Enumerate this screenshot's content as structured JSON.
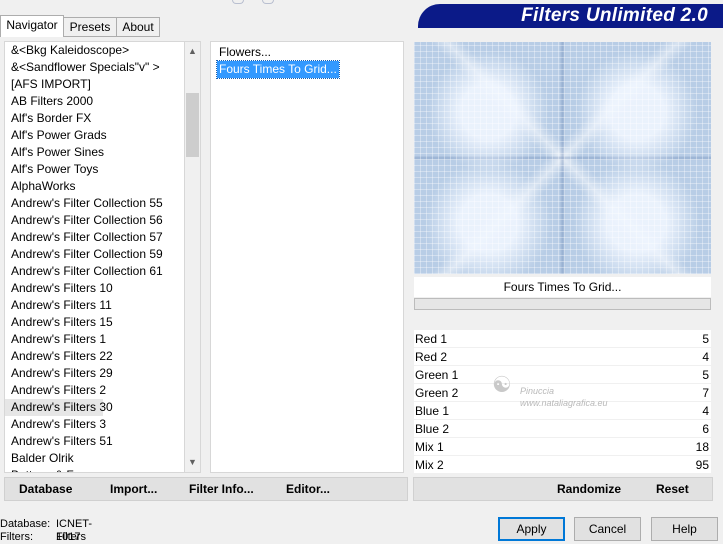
{
  "tabs": [
    {
      "label": "Navigator",
      "active": true
    },
    {
      "label": "Presets",
      "active": false
    },
    {
      "label": "About",
      "active": false
    }
  ],
  "banner": {
    "title": "Filters Unlimited 2.0",
    "color": "#0b1a88"
  },
  "categories": [
    "&<Bkg Kaleidoscope>",
    "&<Sandflower Specials\"v\" >",
    "[AFS IMPORT]",
    "AB Filters 2000",
    "Alf's Border FX",
    "Alf's Power Grads",
    "Alf's Power Sines",
    "Alf's Power Toys",
    "AlphaWorks",
    "Andrew's Filter Collection 55",
    "Andrew's Filter Collection 56",
    "Andrew's Filter Collection 57",
    "Andrew's Filter Collection 59",
    "Andrew's Filter Collection 61",
    "Andrew's Filters 10",
    "Andrew's Filters 11",
    "Andrew's Filters 15",
    "Andrew's Filters 1",
    "Andrew's Filters 22",
    "Andrew's Filters 29",
    "Andrew's Filters 2",
    "Andrew's Filters 30",
    "Andrew's Filters 3",
    "Andrew's Filters 51",
    "Balder Olrik",
    "Buttons & Frames"
  ],
  "hovered_category": "Andrew's Filters 30",
  "filters": [
    {
      "label": "Flowers...",
      "selected": false
    },
    {
      "label": "Fours Times To Grid...",
      "selected": true
    }
  ],
  "preview": {
    "filter_name": "Fours Times To Grid..."
  },
  "parameters": [
    {
      "label": "Red 1",
      "value": "5"
    },
    {
      "label": "Red 2",
      "value": "4"
    },
    {
      "label": "Green 1",
      "value": "5"
    },
    {
      "label": "Green 2",
      "value": "7"
    },
    {
      "label": "Blue 1",
      "value": "4"
    },
    {
      "label": "Blue 2",
      "value": "6"
    },
    {
      "label": "Mix 1",
      "value": "18"
    },
    {
      "label": "Mix 2",
      "value": "95"
    }
  ],
  "watermark": {
    "name": "Pinuccia",
    "url": "www.nataliagrafica.eu"
  },
  "toolbar": {
    "database": "Database",
    "import": "Import...",
    "filter_info": "Filter Info...",
    "editor": "Editor...",
    "randomize": "Randomize",
    "reset": "Reset"
  },
  "status": {
    "database_label": "Database:",
    "database_value": "ICNET-Filters",
    "filters_label": "Filters:",
    "filters_value": "1017"
  },
  "buttons": {
    "apply": "Apply",
    "cancel": "Cancel",
    "help": "Help"
  },
  "icons": {
    "scroll_up": "chevron-up-icon",
    "scroll_down": "chevron-down-icon"
  }
}
